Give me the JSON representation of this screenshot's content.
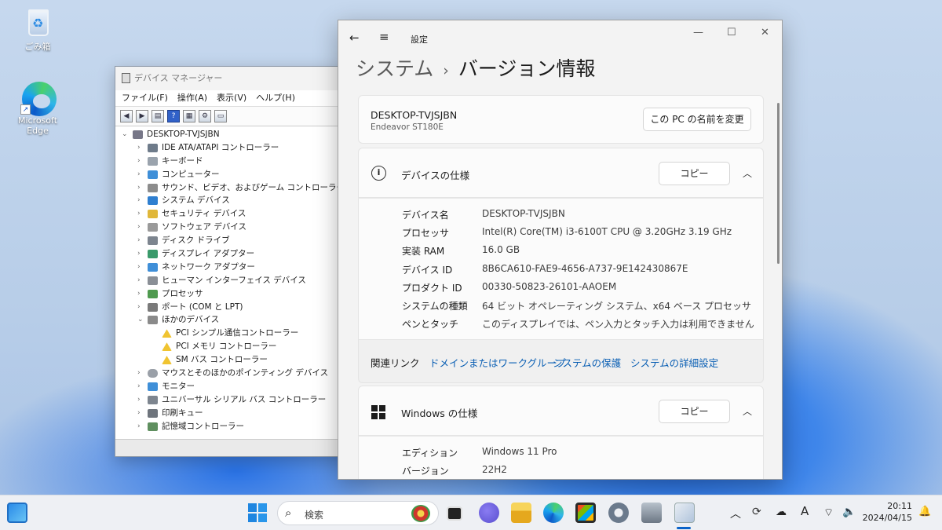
{
  "desktop": {
    "recycle_label": "ごみ箱",
    "edge_label": "Microsoft Edge"
  },
  "devmgr": {
    "title": "デバイス マネージャー",
    "menu": [
      "ファイル(F)",
      "操作(A)",
      "表示(V)",
      "ヘルプ(H)"
    ],
    "root": "DESKTOP-TVJSJBN",
    "categories": [
      "IDE ATA/ATAPI コントローラー",
      "キーボード",
      "コンピューター",
      "サウンド、ビデオ、およびゲーム コントローラー",
      "システム デバイス",
      "セキュリティ デバイス",
      "ソフトウェア デバイス",
      "ディスク ドライブ",
      "ディスプレイ アダプター",
      "ネットワーク アダプター",
      "ヒューマン インターフェイス デバイス",
      "プロセッサ",
      "ポート (COM と LPT)",
      "ほかのデバイス"
    ],
    "other_devices": [
      "PCI シンプル通信コントローラー",
      "PCI メモリ コントローラー",
      "SM バス コントローラー"
    ],
    "categories2": [
      "マウスとそのほかのポインティング デバイス",
      "モニター",
      "ユニバーサル シリアル バス コントローラー",
      "印刷キュー",
      "記憶域コントローラー"
    ]
  },
  "settings": {
    "app_title": "設定",
    "crumb_parent": "システム",
    "crumb_sep": "›",
    "crumb_current": "バージョン情報",
    "pc_name": "DESKTOP-TVJSJBN",
    "pc_model": "Endeavor ST180E",
    "rename_button": "この PC の名前を変更",
    "device_spec_title": "デバイスの仕様",
    "copy_label": "コピー",
    "device_specs": [
      {
        "k": "デバイス名",
        "v": "DESKTOP-TVJSJBN"
      },
      {
        "k": "プロセッサ",
        "v": "Intel(R) Core(TM) i3-6100T CPU @ 3.20GHz   3.19 GHz"
      },
      {
        "k": "実装 RAM",
        "v": "16.0 GB"
      },
      {
        "k": "デバイス ID",
        "v": "8B6CA610-FAE9-4656-A737-9E142430867E"
      },
      {
        "k": "プロダクト ID",
        "v": "00330-50823-26101-AAOEM"
      },
      {
        "k": "システムの種類",
        "v": "64 ビット オペレーティング システム、x64 ベース プロセッサ"
      },
      {
        "k": "ペンとタッチ",
        "v": "このディスプレイでは、ペン入力とタッチ入力は利用できません"
      }
    ],
    "related_links_label": "関連リンク",
    "related_links": [
      "ドメインまたはワークグループ",
      "システムの保護",
      "システムの詳細設定"
    ],
    "windows_spec_title": "Windows の仕様",
    "windows_specs": [
      {
        "k": "エディション",
        "v": "Windows 11 Pro"
      },
      {
        "k": "バージョン",
        "v": "22H2"
      }
    ]
  },
  "taskbar": {
    "search_placeholder": "検索",
    "ime": "A",
    "time": "20:11",
    "date": "2024/04/15"
  }
}
